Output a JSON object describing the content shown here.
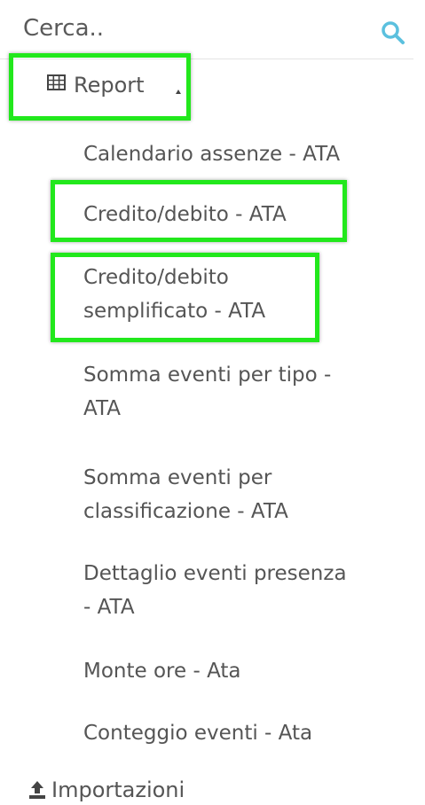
{
  "search": {
    "placeholder": "Cerca..",
    "icon": "search-icon",
    "icon_color": "#5bc0de"
  },
  "menu": {
    "report": {
      "label": "Report",
      "icon": "table-icon",
      "caret": "caret-up-icon",
      "expanded": true,
      "items": [
        {
          "line1": "Calendario assenze - ATA",
          "line2": ""
        },
        {
          "line1": "Credito/debito - ATA",
          "line2": ""
        },
        {
          "line1": "Credito/debito",
          "line2": "semplificato - ATA"
        },
        {
          "line1": "Somma eventi per tipo -",
          "line2": "ATA"
        },
        {
          "line1": "Somma eventi per",
          "line2": "classificazione - ATA"
        },
        {
          "line1": "Dettaglio eventi presenza",
          "line2": "- ATA"
        },
        {
          "line1": "Monte ore - Ata",
          "line2": ""
        },
        {
          "line1": "Conteggio eventi - Ata",
          "line2": ""
        }
      ]
    },
    "importazioni": {
      "label": "Importazioni",
      "icon": "upload-icon"
    }
  },
  "highlight_color": "#22e81c"
}
